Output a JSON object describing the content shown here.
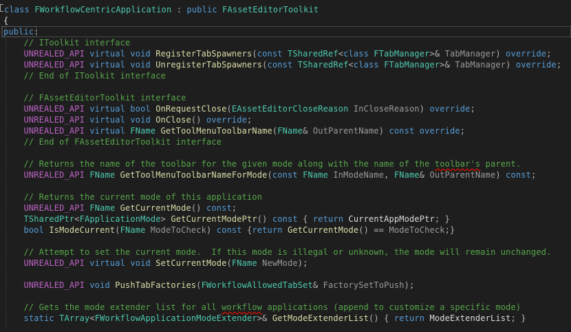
{
  "colors": {
    "background": "#1e1e1e",
    "keyword": "#569cd6",
    "type": "#4ec9b0",
    "function": "#dcdcaa",
    "comment": "#57a64a",
    "macro": "#bd63c5",
    "parameter": "#9a9a9a",
    "plain": "#dcdcdc",
    "error_squiggle": "#e51400"
  },
  "editor": {
    "language": "cpp",
    "lines": [
      {
        "tokens": [
          [
            "kw",
            "class "
          ],
          [
            "ty",
            "FWorkflowCentricApplication"
          ],
          [
            "op",
            " : "
          ],
          [
            "kw",
            "public "
          ],
          [
            "ty",
            "FAssetEditorToolkit"
          ]
        ]
      },
      {
        "tokens": [
          [
            "pl",
            "{"
          ]
        ]
      },
      {
        "tokens": [
          [
            "kw",
            "public"
          ],
          [
            "op",
            ":"
          ]
        ]
      },
      {
        "tokens": [
          [
            "pl",
            "    "
          ],
          [
            "cm",
            "// IToolkit interface"
          ]
        ]
      },
      {
        "tokens": [
          [
            "pl",
            "    "
          ],
          [
            "mac",
            "UNREALED_API "
          ],
          [
            "kw",
            "virtual void "
          ],
          [
            "fn",
            "RegisterTabSpawners"
          ],
          [
            "op",
            "("
          ],
          [
            "kw",
            "const "
          ],
          [
            "ty",
            "TSharedRef"
          ],
          [
            "op",
            "<"
          ],
          [
            "kw",
            "class "
          ],
          [
            "ty",
            "FTabManager"
          ],
          [
            "op",
            ">& "
          ],
          [
            "par",
            "TabManager"
          ],
          [
            "op",
            ") "
          ],
          [
            "kw",
            "override"
          ],
          [
            "op",
            ";"
          ]
        ]
      },
      {
        "tokens": [
          [
            "pl",
            "    "
          ],
          [
            "mac",
            "UNREALED_API "
          ],
          [
            "kw",
            "virtual void "
          ],
          [
            "fn",
            "UnregisterTabSpawners"
          ],
          [
            "op",
            "("
          ],
          [
            "kw",
            "const "
          ],
          [
            "ty",
            "TSharedRef"
          ],
          [
            "op",
            "<"
          ],
          [
            "kw",
            "class "
          ],
          [
            "ty",
            "FTabManager"
          ],
          [
            "op",
            ">& "
          ],
          [
            "par",
            "TabManager"
          ],
          [
            "op",
            ") "
          ],
          [
            "kw",
            "override"
          ],
          [
            "op",
            ";"
          ]
        ]
      },
      {
        "tokens": [
          [
            "pl",
            "    "
          ],
          [
            "cm",
            "// End of IToolkit interface"
          ]
        ]
      },
      {
        "tokens": []
      },
      {
        "tokens": [
          [
            "pl",
            "    "
          ],
          [
            "cm",
            "// FAssetEditorToolkit interface"
          ]
        ]
      },
      {
        "tokens": [
          [
            "pl",
            "    "
          ],
          [
            "mac",
            "UNREALED_API "
          ],
          [
            "kw",
            "virtual bool "
          ],
          [
            "fn",
            "OnRequestClose"
          ],
          [
            "op",
            "("
          ],
          [
            "ty",
            "EAssetEditorCloseReason "
          ],
          [
            "par",
            "InCloseReason"
          ],
          [
            "op",
            ") "
          ],
          [
            "kw",
            "override"
          ],
          [
            "op",
            ";"
          ]
        ]
      },
      {
        "tokens": [
          [
            "pl",
            "    "
          ],
          [
            "mac",
            "UNREALED_API "
          ],
          [
            "kw",
            "virtual void "
          ],
          [
            "fn",
            "OnClose"
          ],
          [
            "op",
            "() "
          ],
          [
            "kw",
            "override"
          ],
          [
            "op",
            ";"
          ]
        ]
      },
      {
        "tokens": [
          [
            "pl",
            "    "
          ],
          [
            "mac",
            "UNREALED_API "
          ],
          [
            "kw",
            "virtual "
          ],
          [
            "ty",
            "FName "
          ],
          [
            "fn",
            "GetToolMenuToolbarName"
          ],
          [
            "op",
            "("
          ],
          [
            "ty",
            "FName"
          ],
          [
            "op",
            "& "
          ],
          [
            "par",
            "OutParentName"
          ],
          [
            "op",
            ") "
          ],
          [
            "kw",
            "const override"
          ],
          [
            "op",
            ";"
          ]
        ]
      },
      {
        "tokens": [
          [
            "pl",
            "    "
          ],
          [
            "cm",
            "// End of FAssetEditorToolkit interface"
          ]
        ]
      },
      {
        "tokens": []
      },
      {
        "tokens": [
          [
            "pl",
            "    "
          ],
          [
            "cm",
            "// Returns the name of the toolbar for the given mode along with the name of the "
          ],
          [
            "cm squig",
            "toolbar's"
          ],
          [
            "cm",
            " parent."
          ]
        ]
      },
      {
        "tokens": [
          [
            "pl",
            "    "
          ],
          [
            "mac",
            "UNREALED_API "
          ],
          [
            "ty",
            "FName "
          ],
          [
            "fn",
            "GetToolMenuToolbarNameForMode"
          ],
          [
            "op",
            "("
          ],
          [
            "kw",
            "const "
          ],
          [
            "ty",
            "FName "
          ],
          [
            "par",
            "InModeName"
          ],
          [
            "op",
            ", "
          ],
          [
            "ty",
            "FName"
          ],
          [
            "op",
            "& "
          ],
          [
            "par",
            "OutParentName"
          ],
          [
            "op",
            ") "
          ],
          [
            "kw",
            "const"
          ],
          [
            "op",
            ";"
          ]
        ]
      },
      {
        "tokens": []
      },
      {
        "tokens": [
          [
            "pl",
            "    "
          ],
          [
            "cm",
            "// Returns the current mode of this application"
          ]
        ]
      },
      {
        "tokens": [
          [
            "pl",
            "    "
          ],
          [
            "mac",
            "UNREALED_API "
          ],
          [
            "ty",
            "FName "
          ],
          [
            "fn",
            "GetCurrentMode"
          ],
          [
            "op",
            "() "
          ],
          [
            "kw",
            "const"
          ],
          [
            "op",
            ";"
          ]
        ]
      },
      {
        "tokens": [
          [
            "pl",
            "    "
          ],
          [
            "ty",
            "TSharedPtr"
          ],
          [
            "op",
            "<"
          ],
          [
            "ty",
            "FApplicationMode"
          ],
          [
            "op",
            "> "
          ],
          [
            "fn",
            "GetCurrentModePtr"
          ],
          [
            "op",
            "() "
          ],
          [
            "kw",
            "const "
          ],
          [
            "op",
            "{ "
          ],
          [
            "kw",
            "return "
          ],
          [
            "pl",
            "CurrentAppModePtr"
          ],
          [
            "op",
            "; }"
          ]
        ]
      },
      {
        "tokens": [
          [
            "pl",
            "    "
          ],
          [
            "kw",
            "bool "
          ],
          [
            "fn",
            "IsModeCurrent"
          ],
          [
            "op",
            "("
          ],
          [
            "ty",
            "FName "
          ],
          [
            "par",
            "ModeToCheck"
          ],
          [
            "op",
            ") "
          ],
          [
            "kw",
            "const "
          ],
          [
            "op",
            "{"
          ],
          [
            "kw",
            "return "
          ],
          [
            "fn",
            "GetCurrentMode"
          ],
          [
            "op",
            "() == "
          ],
          [
            "par",
            "ModeToCheck"
          ],
          [
            "op",
            ";}"
          ]
        ]
      },
      {
        "tokens": []
      },
      {
        "tokens": [
          [
            "pl",
            "    "
          ],
          [
            "cm",
            "// Attempt to set the current mode.  If this mode is illegal or unknown, the mode will remain unchanged."
          ]
        ]
      },
      {
        "tokens": [
          [
            "pl",
            "    "
          ],
          [
            "mac",
            "UNREALED_API "
          ],
          [
            "kw",
            "virtual void "
          ],
          [
            "fn",
            "SetCurrentMode"
          ],
          [
            "op",
            "("
          ],
          [
            "ty",
            "FName "
          ],
          [
            "par",
            "NewMode"
          ],
          [
            "op",
            ");"
          ]
        ]
      },
      {
        "tokens": []
      },
      {
        "tokens": [
          [
            "pl",
            "    "
          ],
          [
            "mac",
            "UNREALED_API "
          ],
          [
            "kw",
            "void "
          ],
          [
            "fn",
            "PushTabFactories"
          ],
          [
            "op",
            "("
          ],
          [
            "ty",
            "FWorkflowAllowedTabSet"
          ],
          [
            "op",
            "& "
          ],
          [
            "par",
            "FactorySetToPush"
          ],
          [
            "op",
            ");"
          ]
        ]
      },
      {
        "tokens": []
      },
      {
        "tokens": [
          [
            "pl",
            "    "
          ],
          [
            "cm",
            "// Gets the mode extender list for all "
          ],
          [
            "cm squig",
            "workflow"
          ],
          [
            "cm",
            " applications (append to customize a specific mode)"
          ]
        ]
      },
      {
        "tokens": [
          [
            "pl",
            "    "
          ],
          [
            "kw",
            "static "
          ],
          [
            "ty",
            "TArray"
          ],
          [
            "op",
            "<"
          ],
          [
            "ty",
            "FWorkflowApplicationModeExtender"
          ],
          [
            "op",
            ">& "
          ],
          [
            "fn",
            "GetModeExtenderList"
          ],
          [
            "op",
            "() { "
          ],
          [
            "kw",
            "return "
          ],
          [
            "pl",
            "ModeExtenderList"
          ],
          [
            "op",
            "; }"
          ]
        ]
      }
    ]
  }
}
